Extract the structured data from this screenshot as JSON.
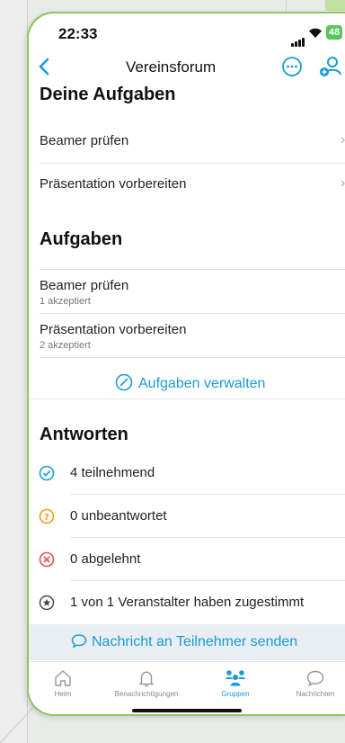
{
  "status": {
    "time": "22:33",
    "battery": "48"
  },
  "nav": {
    "title": "Vereinsforum",
    "back_icon": "chevron-left-icon",
    "more_icon": "more-circle-icon",
    "people_icon": "people-add-icon"
  },
  "my_tasks": {
    "heading": "Deine Aufgaben",
    "items": [
      {
        "label": "Beamer prüfen"
      },
      {
        "label": "Präsentation vorbereiten"
      }
    ]
  },
  "tasks": {
    "heading": "Aufgaben",
    "items": [
      {
        "label": "Beamer prüfen",
        "sub": "1 akzeptiert"
      },
      {
        "label": "Präsentation vorbereiten",
        "sub": "2 akzeptiert"
      }
    ],
    "manage_label": "Aufgaben verwalten"
  },
  "answers": {
    "heading": "Antworten",
    "items": [
      {
        "label": "4 teilnehmend",
        "icon": "check-circle-icon",
        "color": "#1a9bd7"
      },
      {
        "label": "0 unbeantwortet",
        "icon": "question-circle-icon",
        "color": "#f29a1e"
      },
      {
        "label": "0 abgelehnt",
        "icon": "x-circle-icon",
        "color": "#e0524b"
      },
      {
        "label": "1 von 1 Veranstalter haben zugestimmt",
        "icon": "star-circle-icon",
        "color": "#444444"
      }
    ]
  },
  "send_label": "Nachricht an Teilnehmer senden",
  "tabs": [
    {
      "label": "Heim"
    },
    {
      "label": "Benachrichtigungen"
    },
    {
      "label": "Gruppen"
    },
    {
      "label": "Nachrichten"
    }
  ],
  "colors": {
    "accent": "#1a9bd7",
    "frame": "#8fc45e"
  }
}
